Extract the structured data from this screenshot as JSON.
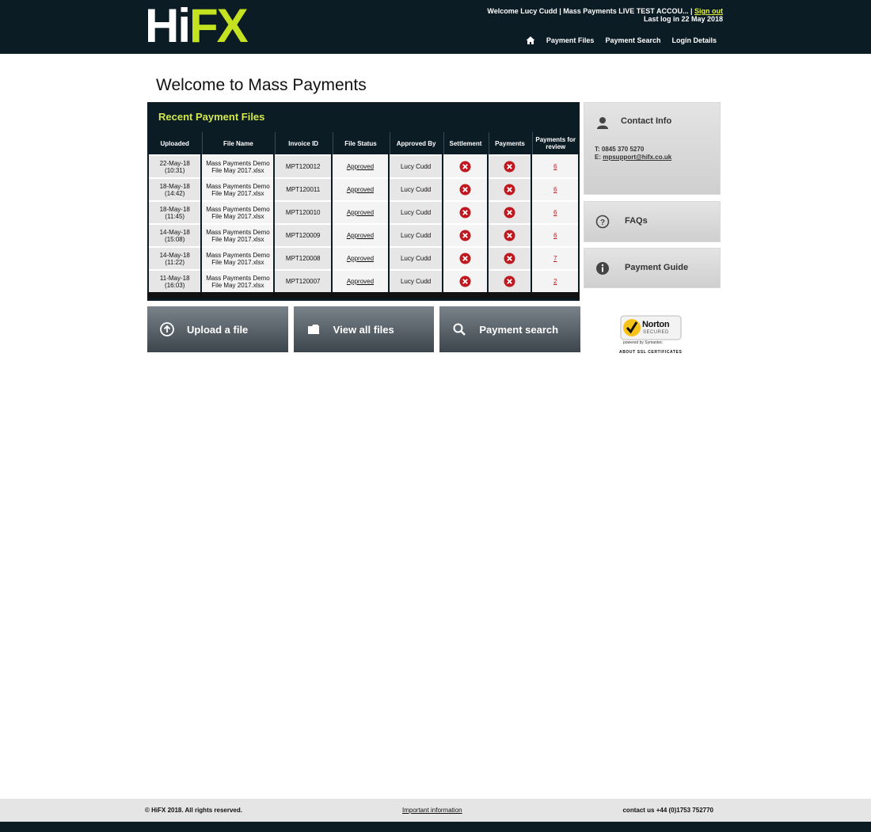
{
  "header": {
    "logo": {
      "hi": "Hi",
      "fx": "FX"
    },
    "welcome_text": "Welcome Lucy Cudd | Mass Payments LIVE TEST ACCOU... |",
    "signout_label": "Sign out",
    "last_login": "Last log in 22 May 2018",
    "nav": [
      "Payment Files",
      "Payment Search",
      "Login Details"
    ],
    "icons": {
      "home": "home-icon"
    }
  },
  "main": {
    "page_title": "Welcome to Mass Payments",
    "recent_title": "Recent Payment Files",
    "table": {
      "headers": [
        "Uploaded",
        "File Name",
        "Invoice ID",
        "File Status",
        "Approved By",
        "Settlement",
        "Payments",
        "Payments for review"
      ],
      "rows": [
        {
          "date": "22-May-18",
          "time": "(10:31)",
          "file1": "Mass Payments Demo",
          "file2": "File May 2017.xlsx",
          "invoice": "MPT120012",
          "status": "Approved",
          "approved_by": "Lucy Cudd",
          "review": "6"
        },
        {
          "date": "18-May-18",
          "time": "(14:42)",
          "file1": "Mass Payments Demo",
          "file2": "File May 2017.xlsx",
          "invoice": "MPT120011",
          "status": "Approved",
          "approved_by": "Lucy Cudd",
          "review": "6"
        },
        {
          "date": "18-May-18",
          "time": "(11:45)",
          "file1": "Mass Payments Demo",
          "file2": "File May 2017.xlsx",
          "invoice": "MPT120010",
          "status": "Approved",
          "approved_by": "Lucy Cudd",
          "review": "6"
        },
        {
          "date": "14-May-18",
          "time": "(15:08)",
          "file1": "Mass Payments Demo",
          "file2": "File May 2017.xlsx",
          "invoice": "MPT120009",
          "status": "Approved",
          "approved_by": "Lucy Cudd",
          "review": "6"
        },
        {
          "date": "14-May-18",
          "time": "(11:22)",
          "file1": "Mass Payments Demo",
          "file2": "File May 2017.xlsx",
          "invoice": "MPT120008",
          "status": "Approved",
          "approved_by": "Lucy Cudd",
          "review": "7"
        },
        {
          "date": "11-May-18",
          "time": "(16:03)",
          "file1": "Mass Payments Demo",
          "file2": "File May 2017.xlsx",
          "invoice": "MPT120007",
          "status": "Approved",
          "approved_by": "Lucy Cudd",
          "review": "2"
        }
      ],
      "icons": {
        "settlement": "error-x-icon",
        "payments": "error-x-icon"
      }
    },
    "actions": [
      {
        "label": "Upload a file",
        "icon": "upload-icon"
      },
      {
        "label": "View all files",
        "icon": "folder-icon"
      },
      {
        "label": "Payment search",
        "icon": "search-icon"
      }
    ]
  },
  "sidebar": {
    "contact": {
      "title": "Contact Info",
      "phone": "T: 0845 370 5270",
      "email_prefix": "E:",
      "email": "mpsupport@hifx.co.uk",
      "icon": "person-icon"
    },
    "faqs": {
      "title": "FAQs",
      "icon": "question-icon"
    },
    "guide": {
      "title": "Payment Guide",
      "icon": "info-icon"
    },
    "norton": {
      "brand": "Norton",
      "secured": "SECURED",
      "powered": "powered by Symantec",
      "about": "ABOUT SSL CERTIFICATES"
    }
  },
  "footer": {
    "copyright": "© HiFX 2018. All rights reserved.",
    "important": "Important information",
    "contact": "contact us +44 (0)1753 752770"
  },
  "colors": {
    "header_bg": "#0c1c25",
    "accent_green": "#c4e21f",
    "error_red": "#c0181f"
  }
}
